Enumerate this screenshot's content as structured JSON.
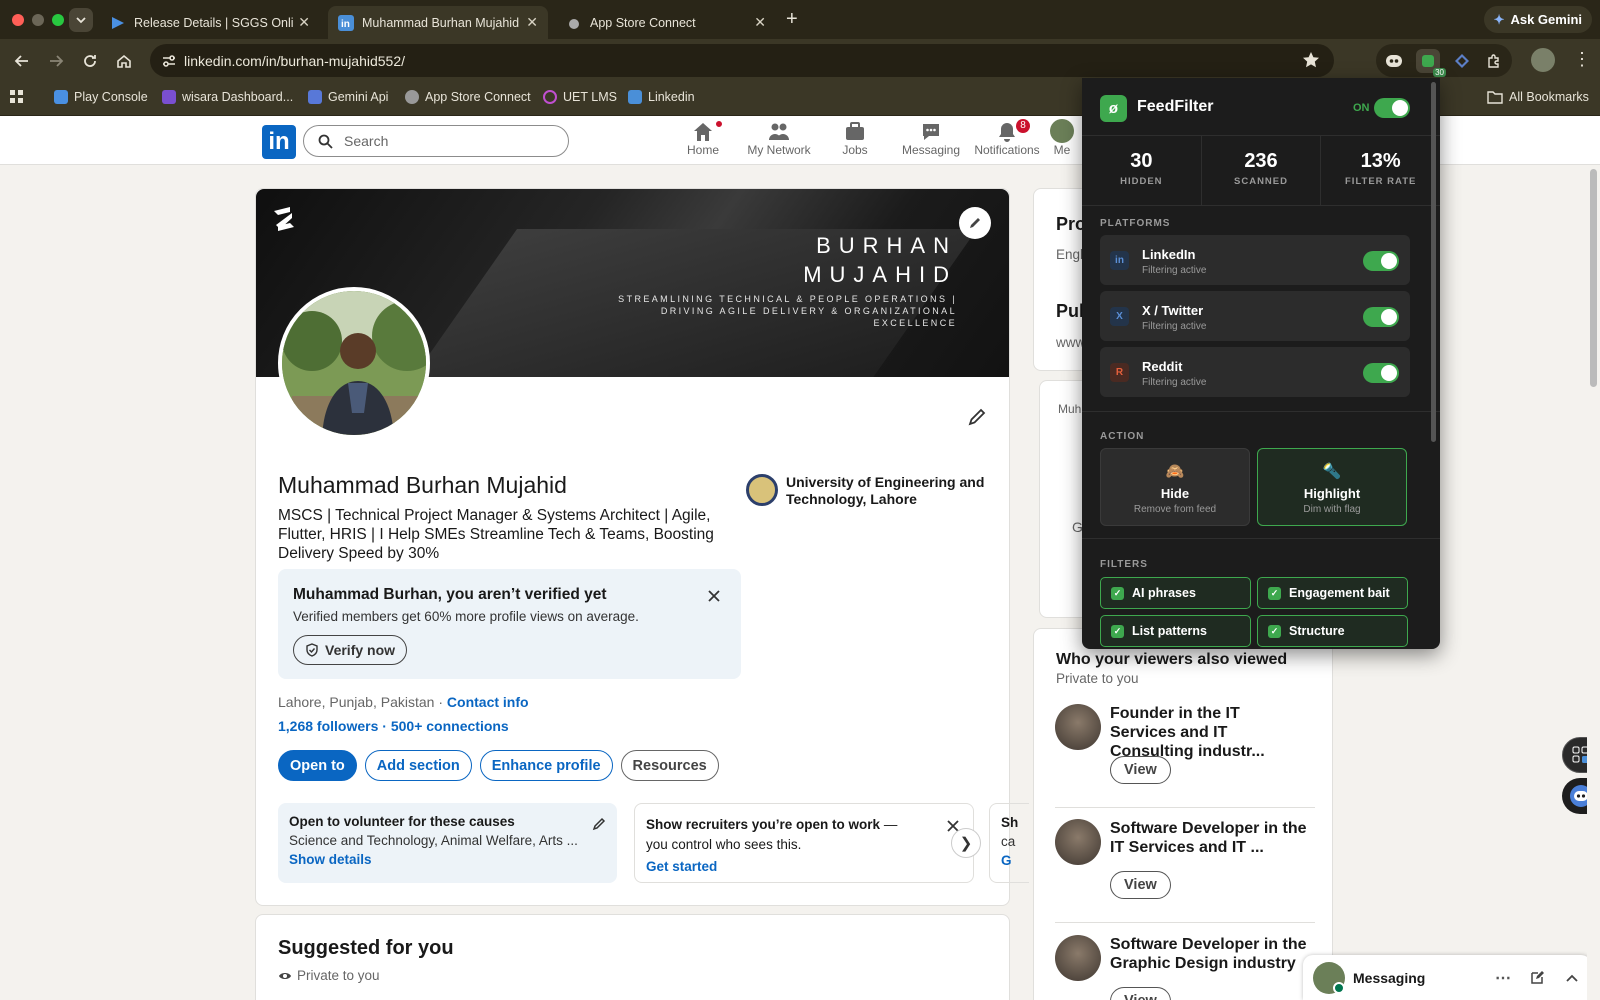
{
  "browser": {
    "tabs": [
      {
        "title": "Release Details | SGGS Online",
        "icon": "play-console-icon"
      },
      {
        "title": "Muhammad Burhan Mujahid | LinkedIn",
        "icon": "linkedin-icon"
      },
      {
        "title": "App Store Connect",
        "icon": "apple-icon"
      }
    ],
    "ask_gemini": "Ask Gemini",
    "url": "linkedin.com/in/burhan-mujahid552/",
    "extension_badge": "30",
    "bookmarks": [
      "Play Console",
      "wisara Dashboard...",
      "Gemini Api",
      "App Store Connect",
      "UET LMS",
      "Linkedin"
    ],
    "all_bookmarks": "All Bookmarks"
  },
  "linkedin": {
    "search_placeholder": "Search",
    "nav": [
      {
        "label": "Home",
        "badge": "",
        "icon": "home-icon"
      },
      {
        "label": "My Network",
        "badge": "",
        "icon": "network-icon"
      },
      {
        "label": "Jobs",
        "badge": "",
        "icon": "jobs-icon"
      },
      {
        "label": "Messaging",
        "badge": "",
        "icon": "messaging-icon"
      },
      {
        "label": "Notifications",
        "badge": "8",
        "icon": "bell-icon"
      },
      {
        "label": "Me",
        "badge": "",
        "icon": "me-avatar"
      }
    ]
  },
  "profile": {
    "banner_name_line1": "BURHAN",
    "banner_name_line2": "MUJAHID",
    "banner_tagline": "STREAMLINING TECHNICAL & PEOPLE OPERATIONS | DRIVING AGILE DELIVERY & ORGANIZATIONAL EXCELLENCE",
    "name": "Muhammad Burhan Mujahid",
    "headline": "MSCS | Technical Project Manager & Systems Architect | Agile, Flutter, HRIS | I Help SMEs Streamline Tech & Teams, Boosting Delivery Speed by 30%",
    "education": "University of Engineering and Technology, Lahore",
    "verify_title": "Muhammad Burhan, you aren’t verified yet",
    "verify_sub": "Verified members get 60% more profile views on average.",
    "verify_button": "Verify now",
    "location": "Lahore, Punjab, Pakistan",
    "contact_sep": " · ",
    "contact_info": "Contact info",
    "followers": "1,268 followers",
    "connections_sep": " · ",
    "connections": "500+ connections",
    "buttons": {
      "open_to": "Open to",
      "add_section": "Add section",
      "enhance": "Enhance profile",
      "resources": "Resources"
    },
    "tiles": [
      {
        "title": "Open to volunteer for these causes",
        "text": "Science and Technology, Animal Welfare, Arts ...",
        "link": "Show details"
      },
      {
        "title": "Show recruiters you’re open to work",
        "title_rest": " — you control who sees this.",
        "link": "Get started"
      },
      {
        "title": "Sh",
        "text": "ca",
        "link": "G"
      }
    ]
  },
  "suggested": {
    "title": "Suggested for you",
    "sub": "Private to you"
  },
  "right_col": {
    "profile_lang_head": "Pro",
    "profile_lang_sub": "Engl",
    "public_head": "Pul",
    "public_sub": "www",
    "ad_text_1": "Muh",
    "ad_text_2": "G",
    "viewers_title": "Who your viewers also viewed",
    "viewers_sub": "Private to you",
    "viewers": [
      {
        "title": "Founder in the IT Services and IT Consulting industr...",
        "button": "View"
      },
      {
        "title": "Software Developer in the IT Services and IT ...",
        "button": "View"
      },
      {
        "title": "Software Developer in the Graphic Design industry",
        "button": "View"
      }
    ]
  },
  "messaging": {
    "label": "Messaging"
  },
  "feedfilter": {
    "title": "FeedFilter",
    "status": "ON",
    "stats": [
      {
        "value": "30",
        "label": "HIDDEN"
      },
      {
        "value": "236",
        "label": "SCANNED"
      },
      {
        "value": "13%",
        "label": "FILTER RATE"
      }
    ],
    "platforms_label": "PLATFORMS",
    "platforms": [
      {
        "name": "LinkedIn",
        "status": "Filtering active",
        "icon_text": "in",
        "icon_color": "#5b8fd6"
      },
      {
        "name": "X / Twitter",
        "status": "Filtering active",
        "icon_text": "X",
        "icon_color": "#5b8fd6"
      },
      {
        "name": "Reddit",
        "status": "Filtering active",
        "icon_text": "R",
        "icon_color": "#e5603c"
      }
    ],
    "action_label": "ACTION",
    "actions": [
      {
        "name": "Hide",
        "sub": "Remove from feed",
        "selected": false
      },
      {
        "name": "Highlight",
        "sub": "Dim with flag",
        "selected": true
      }
    ],
    "filters_label": "FILTERS",
    "filters": [
      "AI phrases",
      "Engagement bait",
      "List patterns",
      "Structure"
    ],
    "accent": "#3ea84e"
  }
}
